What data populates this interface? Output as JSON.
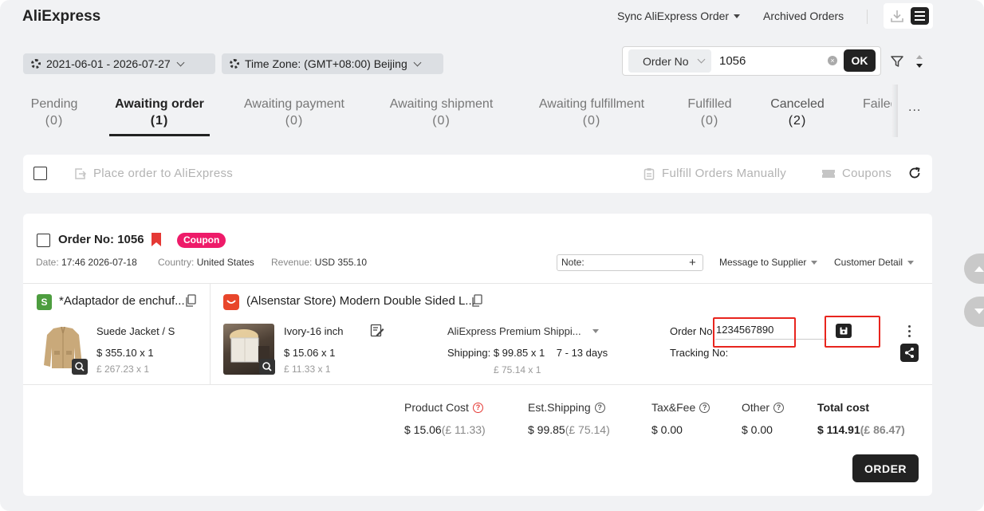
{
  "app_title": "AliExpress",
  "header": {
    "sync_label": "Sync AliExpress Order",
    "archived_label": "Archived Orders"
  },
  "filters": {
    "date_range": "2021-06-01 - 2026-07-27",
    "timezone": "Time Zone: (GMT+08:00) Beijing"
  },
  "search": {
    "type": "Order No",
    "value": "1056",
    "ok_label": "OK"
  },
  "tabs": [
    {
      "label": "Pending",
      "count": "(0)"
    },
    {
      "label": "Awaiting order",
      "count": "(1)"
    },
    {
      "label": "Awaiting payment",
      "count": "(0)"
    },
    {
      "label": "Awaiting shipment",
      "count": "(0)"
    },
    {
      "label": "Awaiting fulfillment",
      "count": "(0)"
    },
    {
      "label": "Fulfilled",
      "count": "(0)"
    },
    {
      "label": "Canceled",
      "count": "(2)"
    },
    {
      "label": "Failed",
      "count": "("
    }
  ],
  "more_label": "...",
  "toolbar": {
    "place_order": "Place order to AliExpress",
    "fulfill_manual": "Fulfill Orders Manually",
    "coupons": "Coupons"
  },
  "order": {
    "label": "Order No:",
    "number": "1056",
    "badge": "Coupon",
    "date_label": "Date:",
    "date": "17:46 2026-07-18",
    "country_label": "Country:",
    "country": "United States",
    "revenue_label": "Revenue:",
    "revenue": "USD 355.10",
    "note_label": "Note:",
    "note_plus": "+",
    "message_supplier": "Message to Supplier",
    "customer_detail": "Customer Detail"
  },
  "shop_item": {
    "title": "*Adaptador de enchuf...",
    "variant": "Suede Jacket / S",
    "price": "$ 355.10 x 1",
    "price_gbp": "£ 267.23 x 1"
  },
  "supplier_item": {
    "title": "(Alsenstar Store) Modern Double Sided L...",
    "variant": "Ivory-16 inch",
    "price": "$ 15.06 x 1",
    "price_gbp": "£ 11.33 x 1",
    "shipping_method": "AliExpress Premium Shippi...",
    "shipping_label": "Shipping:",
    "shipping_price": "$ 99.85 x 1",
    "shipping_days": "7 - 13 days",
    "shipping_gbp": "£ 75.14 x 1",
    "order_no_label": "Order No:",
    "order_no_value": "1234567890",
    "tracking_label": "Tracking No:"
  },
  "costs": {
    "product_label": "Product Cost",
    "product_value": "$ 15.06",
    "product_gbp": "(£ 11.33)",
    "shipping_label": "Est.Shipping",
    "shipping_value": "$ 99.85",
    "shipping_gbp": "(£ 75.14)",
    "tax_label": "Tax&Fee",
    "tax_value": "$ 0.00",
    "other_label": "Other",
    "other_value": "$ 0.00",
    "total_label": "Total cost",
    "total_value": "$ 114.91",
    "total_gbp": "(£ 86.47)"
  },
  "order_button": "ORDER",
  "colors": {
    "accent": "#222222",
    "coupon_badge": "#ee1b69",
    "highlight_box": "#e8251e",
    "bookmark": "#e53935"
  }
}
